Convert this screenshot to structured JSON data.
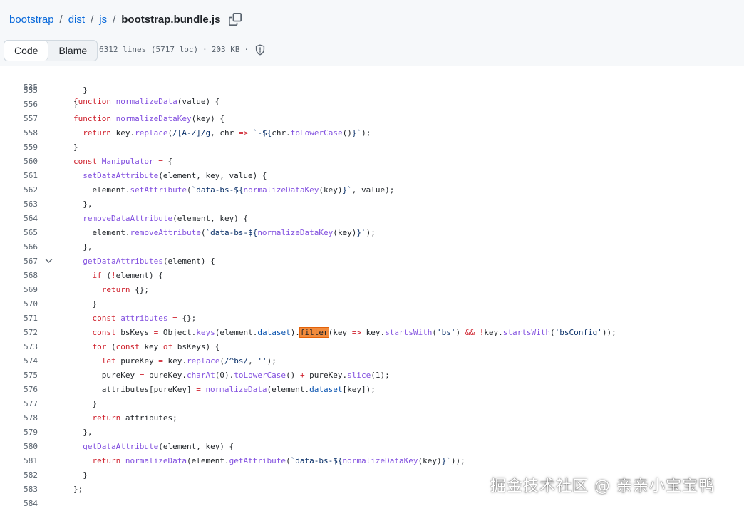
{
  "breadcrumb": {
    "items": [
      "bootstrap",
      "dist",
      "js"
    ],
    "separator": "/",
    "file": "bootstrap.bundle.js"
  },
  "icons": {
    "copy": "copy-icon",
    "shield": "shield-icon",
    "fold": "chevron-down-icon"
  },
  "view_tabs": {
    "code": "Code",
    "blame": "Blame"
  },
  "file_info": {
    "lines": "6312 lines (5717 loc)",
    "dot": "·",
    "size": "203 KB",
    "dot2": "·"
  },
  "sticky": {
    "number": "535",
    "code": "function normalizeData(value) {"
  },
  "lines": [
    {
      "n": "555",
      "code": "  }"
    },
    {
      "n": "556",
      "code": "}"
    },
    {
      "n": "557",
      "code": "function normalizeDataKey(key) {"
    },
    {
      "n": "558",
      "code": "  return key.replace(/[A-Z]/g, chr => `-${chr.toLowerCase()}`);"
    },
    {
      "n": "559",
      "code": "}"
    },
    {
      "n": "560",
      "code": "const Manipulator = {"
    },
    {
      "n": "561",
      "code": "  setDataAttribute(element, key, value) {"
    },
    {
      "n": "562",
      "code": "    element.setAttribute(`data-bs-${normalizeDataKey(key)}`, value);"
    },
    {
      "n": "563",
      "code": "  },"
    },
    {
      "n": "564",
      "code": "  removeDataAttribute(element, key) {"
    },
    {
      "n": "565",
      "code": "    element.removeAttribute(`data-bs-${normalizeDataKey(key)}`);"
    },
    {
      "n": "566",
      "code": "  },"
    },
    {
      "n": "567",
      "code": "  getDataAttributes(element) {"
    },
    {
      "n": "568",
      "code": "    if (!element) {"
    },
    {
      "n": "569",
      "code": "      return {};"
    },
    {
      "n": "570",
      "code": "    }"
    },
    {
      "n": "571",
      "code": "    const attributes = {};"
    },
    {
      "n": "572",
      "code": "    const bsKeys = Object.keys(element.dataset).filter(key => key.startsWith('bs') && !key.startsWith('bsConfig'));"
    },
    {
      "n": "573",
      "code": "    for (const key of bsKeys) {"
    },
    {
      "n": "574",
      "code": "      let pureKey = key.replace(/^bs/, '');"
    },
    {
      "n": "575",
      "code": "      pureKey = pureKey.charAt(0).toLowerCase() + pureKey.slice(1);"
    },
    {
      "n": "576",
      "code": "      attributes[pureKey] = normalizeData(element.dataset[key]);"
    },
    {
      "n": "577",
      "code": "    }"
    },
    {
      "n": "578",
      "code": "    return attributes;"
    },
    {
      "n": "579",
      "code": "  },"
    },
    {
      "n": "580",
      "code": "  getDataAttribute(element, key) {"
    },
    {
      "n": "581",
      "code": "    return normalizeData(element.getAttribute(`data-bs-${normalizeDataKey(key)}`));"
    },
    {
      "n": "582",
      "code": "  }"
    },
    {
      "n": "583",
      "code": "};"
    },
    {
      "n": "584",
      "code": ""
    }
  ],
  "highlight_word": "filter",
  "watermark": "掘金技术社区 @ 亲亲小宝宝鸭"
}
